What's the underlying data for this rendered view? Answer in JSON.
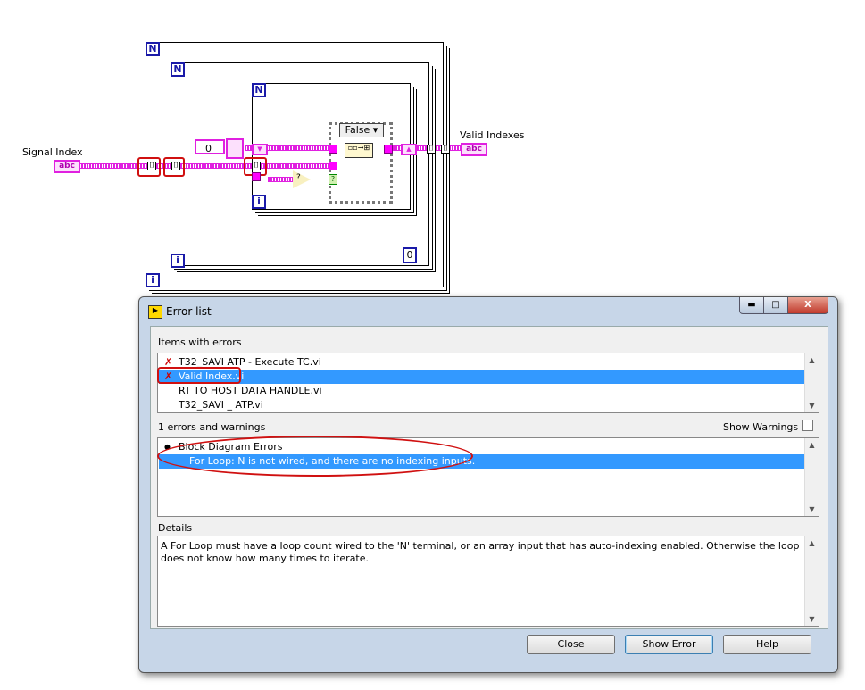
{
  "diagram": {
    "signal_index_label": "Signal Index",
    "valid_indexes_label": "Valid Indexes",
    "string_terminal": "abc",
    "loop_count_terminal": "N",
    "iteration_terminal": "i",
    "numeric_constant": "0",
    "case_selector": "False",
    "constant_zero": "0",
    "compare_glyph": "?"
  },
  "dialog": {
    "title": "Error list",
    "items_label": "Items with errors",
    "items": [
      {
        "label": "T32_SAVI ATP - Execute TC.vi",
        "error": true,
        "selected": false
      },
      {
        "label": "Valid Index.vi",
        "error": true,
        "selected": true
      },
      {
        "label": "RT TO HOST DATA HANDLE.vi",
        "error": false,
        "selected": false
      },
      {
        "label": "T32_SAVI _ ATP.vi",
        "error": false,
        "selected": false
      }
    ],
    "errors_count_label": "1 errors and warnings",
    "show_warnings_label": "Show Warnings",
    "show_warnings_checked": false,
    "errors": [
      {
        "label": "Block Diagram Errors",
        "bullet": "●"
      },
      {
        "label": "For Loop: N is not wired, and there are no indexing inputs.",
        "selected": true
      }
    ],
    "details_label": "Details",
    "details_text": "A For Loop must have a loop count wired to the 'N' terminal, or an array input that has auto-indexing enabled. Otherwise the loop does not know how many times to iterate.",
    "buttons": {
      "close": "Close",
      "show_error": "Show Error",
      "help": "Help"
    },
    "window_buttons": {
      "minimize": "▬",
      "maximize": "□",
      "close": "X"
    },
    "selection_color": "#3399ff",
    "error_color": "#cc0000"
  }
}
